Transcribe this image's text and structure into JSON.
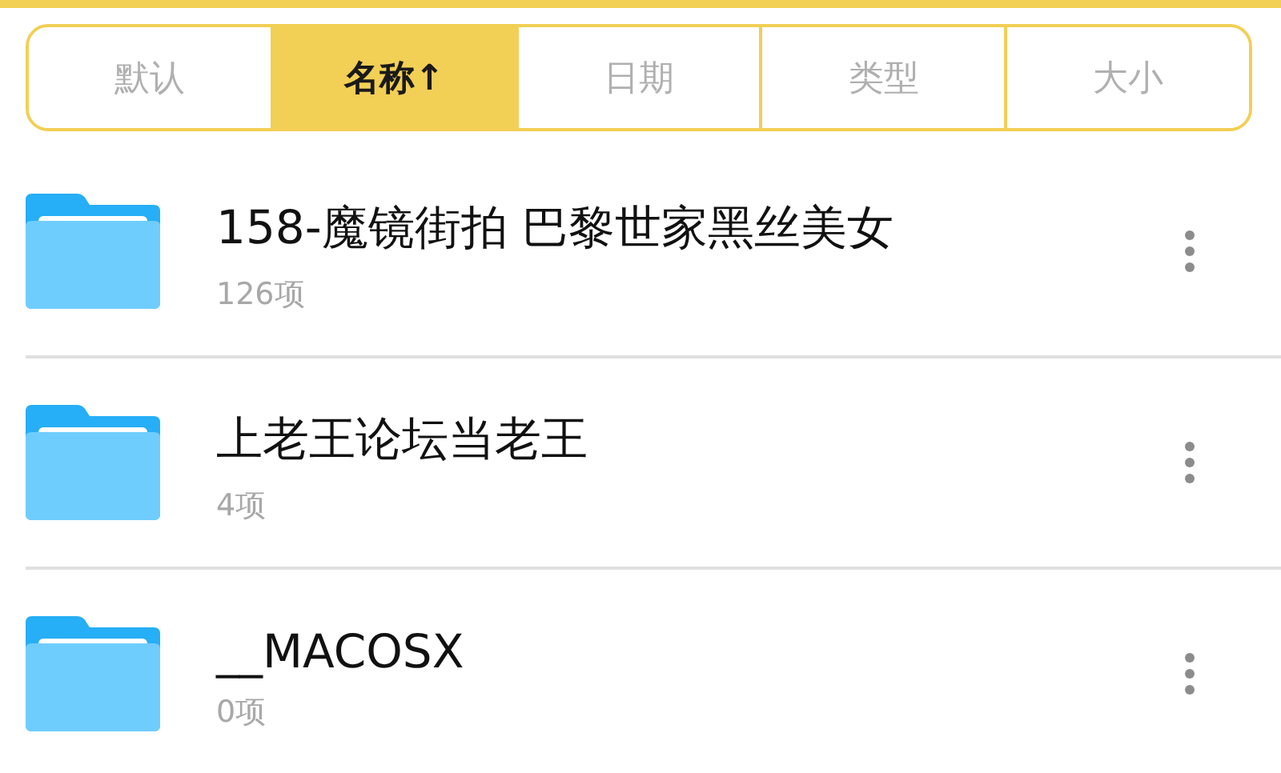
{
  "sort_tabs": [
    {
      "label": "默认",
      "selected": false
    },
    {
      "label": "名称↑",
      "selected": true
    },
    {
      "label": "日期",
      "selected": false
    },
    {
      "label": "类型",
      "selected": false
    },
    {
      "label": "大小",
      "selected": false
    }
  ],
  "files": [
    {
      "name": "158-魔镜街拍 巴黎世家黑丝美女",
      "count": "126项"
    },
    {
      "name": "上老王论坛当老王",
      "count": "4项"
    },
    {
      "name": "__MACOSX",
      "count": "0项"
    }
  ]
}
